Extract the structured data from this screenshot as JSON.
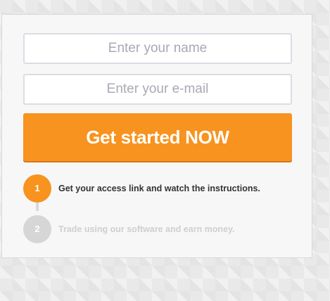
{
  "form": {
    "name_placeholder": "Enter your name",
    "email_placeholder": "Enter your e-mail",
    "submit_label": "Get started NOW"
  },
  "steps": [
    {
      "number": "1",
      "text": "Get your access link and watch the instructions.",
      "state": "active"
    },
    {
      "number": "2",
      "text": "Trade using our software and earn money.",
      "state": "inactive"
    }
  ],
  "colors": {
    "accent": "#f7931e",
    "inactive": "#d6d6d6",
    "card_bg": "#f7f7f7"
  }
}
